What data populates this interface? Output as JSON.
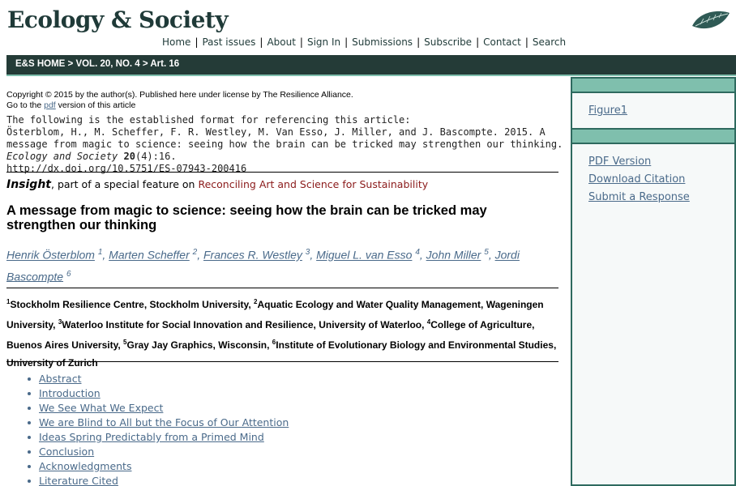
{
  "header": {
    "logo": "Ecology & Society",
    "nav": [
      "Home",
      "Past issues",
      "About",
      "Sign In",
      "Submissions",
      "Subscribe",
      "Contact",
      "Search"
    ]
  },
  "breadcrumb": "E&S HOME > VOL. 20, NO. 4 > Art. 16",
  "copyright": {
    "line1": "Copyright © 2015 by the author(s). Published here under license by The Resilience Alliance.",
    "line2_pre": "Go to the ",
    "line2_link": "pdf",
    "line2_post": " version of this article"
  },
  "reference": {
    "intro": "The following is the established format for referencing this article:",
    "citation": "Österblom, H., M. Scheffer, F. R. Westley, M. Van Esso, J. Miller, and J. Bascompte. 2015. A message from magic to science: seeing how the brain can be tricked may strengthen our thinking. ",
    "journal": "Ecology and Society",
    "volume": "20",
    "issue_page": "(4):16.",
    "doi": "http://dx.doi.org/10.5751/ES-07943-200416"
  },
  "feature": {
    "type": "Insight",
    "middle": ", part of a special feature on ",
    "name": "Reconciling Art and Science for Sustainability"
  },
  "article_title": "A message from magic to science: seeing how the brain can be tricked may strengthen our thinking",
  "authors": [
    {
      "name": "Henrik Österblom",
      "sup": "1"
    },
    {
      "name": "Marten Scheffer",
      "sup": "2"
    },
    {
      "name": "Frances R. Westley",
      "sup": "3"
    },
    {
      "name": "Miguel L. van Esso",
      "sup": "4"
    },
    {
      "name": "John Miller",
      "sup": "5"
    },
    {
      "name": "Jordi Bascompte",
      "sup": "6"
    }
  ],
  "affiliations": [
    {
      "sup": "1",
      "text": "Stockholm Resilience Centre, Stockholm University, "
    },
    {
      "sup": "2",
      "text": "Aquatic Ecology and Water Quality Management, Wageningen University, "
    },
    {
      "sup": "3",
      "text": "Waterloo Institute for Social Innovation and Resilience, University of Waterloo, "
    },
    {
      "sup": "4",
      "text": "College of Agriculture, Buenos Aires University, "
    },
    {
      "sup": "5",
      "text": "Gray Jay Graphics, Wisconsin, "
    },
    {
      "sup": "6",
      "text": "Institute of Evolutionary Biology and Environmental Studies, University of Zurich"
    }
  ],
  "toc": [
    "Abstract",
    "Introduction",
    "We See What We Expect",
    "We are Blind to All but the Focus of Our Attention",
    "Ideas Spring Predictably from a Primed Mind",
    "Conclusion",
    "Acknowledgments",
    "Literature Cited"
  ],
  "sidebar": {
    "figures": [
      "Figure1"
    ],
    "actions": [
      "PDF Version",
      "Download Citation",
      "Submit a Response"
    ]
  },
  "colors": {
    "dark_green": "#243b37",
    "accent_green": "#7fbfad",
    "link_blue": "#4a6a8a",
    "feature_red": "#8b1a1a"
  }
}
